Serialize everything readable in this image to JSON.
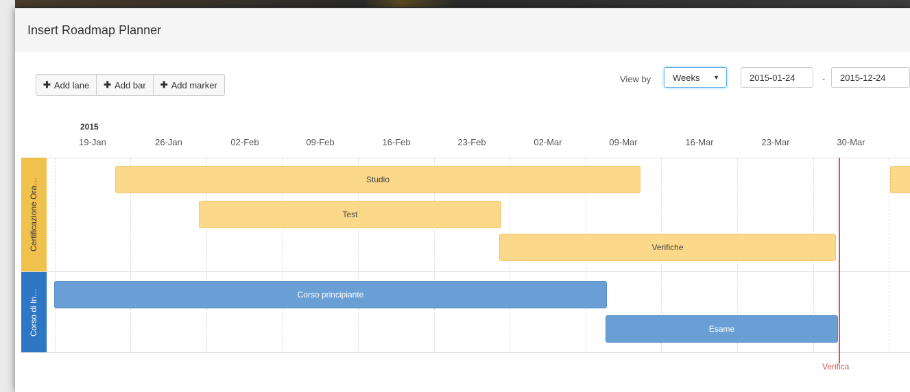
{
  "dialog": {
    "title": "Insert Roadmap Planner"
  },
  "toolbar": {
    "add_lane": "Add lane",
    "add_bar": "Add bar",
    "add_marker": "Add marker",
    "view_by_label": "View by",
    "view_by_value": "Weeks",
    "date_start": "2015-01-24",
    "date_separator": "-",
    "date_end": "2015-12-24"
  },
  "timeline": {
    "year": "2015",
    "ticks": [
      "19-Jan",
      "26-Jan",
      "02-Feb",
      "09-Feb",
      "16-Feb",
      "23-Feb",
      "02-Mar",
      "09-Mar",
      "16-Mar",
      "23-Mar",
      "30-Mar"
    ]
  },
  "lanes": [
    {
      "label": "Certificazione Ora…",
      "color": "#f1c14d",
      "bars": [
        {
          "label": "Studio"
        },
        {
          "label": "Test"
        },
        {
          "label": "Verifiche"
        },
        {
          "label": ""
        }
      ]
    },
    {
      "label": "Corso di In…",
      "color": "#2f76c5",
      "bars": [
        {
          "label": "Corso principiante"
        },
        {
          "label": "Esame"
        }
      ]
    }
  ],
  "marker": {
    "label": "Verifica",
    "color": "#d9534f"
  }
}
